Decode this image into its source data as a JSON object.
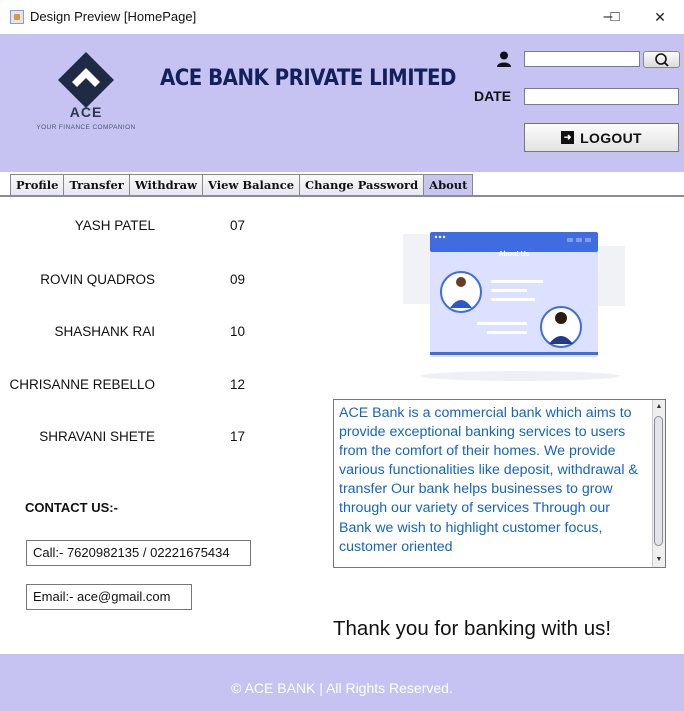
{
  "window": {
    "title": "Design Preview [HomePage]",
    "minimize_glyph": "–",
    "maximize_glyph": "□",
    "close_glyph": "✕"
  },
  "header": {
    "logo_name": "ACE",
    "logo_tagline": "YOUR FINANCE COMPANION",
    "bank_title": "ACE BANK PRIVATE LIMITED",
    "user_value": "",
    "date_label": "DATE",
    "date_value": "",
    "logout_label": "LOGOUT",
    "background": "#c6c3f3"
  },
  "tabs": [
    {
      "label": "Profile"
    },
    {
      "label": "Transfer"
    },
    {
      "label": "Withdraw"
    },
    {
      "label": "View Balance"
    },
    {
      "label": "Change Password"
    },
    {
      "label": "About",
      "active": true
    }
  ],
  "team": [
    {
      "name": "YASH PATEL",
      "number": "07"
    },
    {
      "name": "ROVIN QUADROS",
      "number": "09"
    },
    {
      "name": "SHASHANK RAI",
      "number": "10"
    },
    {
      "name": "CHRISANNE REBELLO",
      "number": "12"
    },
    {
      "name": "SHRAVANI SHETE",
      "number": "17"
    }
  ],
  "contact": {
    "label": "CONTACT US:-",
    "call": "Call:- 7620982135 / 02221675434",
    "email": "Email:- ace@gmail.com"
  },
  "illustration": {
    "card_title": "About Us"
  },
  "about": {
    "text": "ACE Bank is a commercial bank which aims to provide exceptional banking services to users from the comfort of their homes. We provide various functionalities like deposit, withdrawal & transfer Our bank helps businesses to grow through our variety of services Through our Bank we wish to highlight customer focus, customer oriented",
    "text_color": "#1565c0"
  },
  "thanks": "Thank you for banking with us!",
  "footer": {
    "text": "© ACE BANK | All Rights Reserved."
  }
}
